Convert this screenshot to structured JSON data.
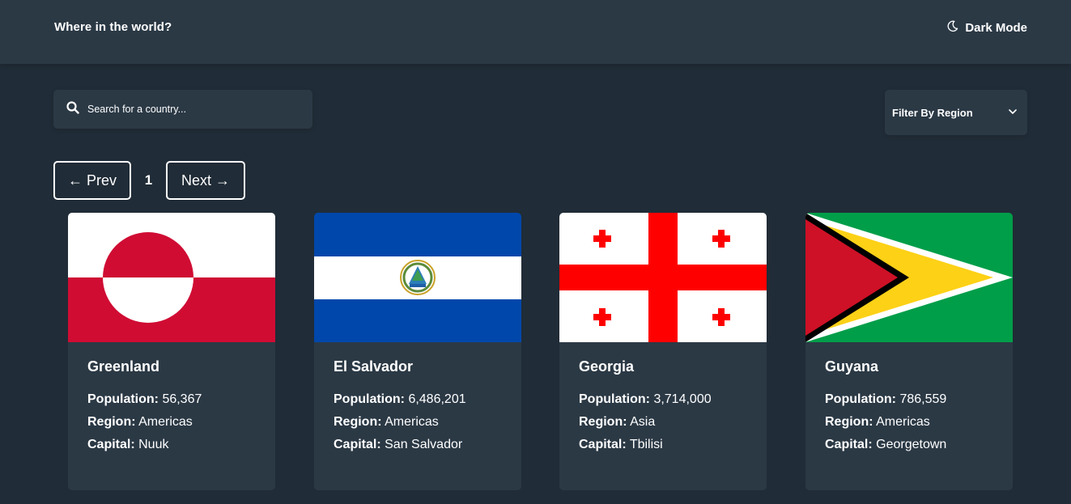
{
  "header": {
    "title": "Where in the world?",
    "mode_label": "Dark Mode"
  },
  "search": {
    "placeholder": "Search for a country..."
  },
  "filter": {
    "label": "Filter By Region"
  },
  "pagination": {
    "prev_label": "← Prev",
    "current_page": "1",
    "next_label": "Next →"
  },
  "labels": {
    "population": "Population:",
    "region": "Region:",
    "capital": "Capital:"
  },
  "countries": [
    {
      "name": "Greenland",
      "population": "56,367",
      "region": "Americas",
      "capital": "Nuuk",
      "flag": "greenland-flag"
    },
    {
      "name": "El Salvador",
      "population": "6,486,201",
      "region": "Americas",
      "capital": "San Salvador",
      "flag": "el-salvador-flag"
    },
    {
      "name": "Georgia",
      "population": "3,714,000",
      "region": "Asia",
      "capital": "Tbilisi",
      "flag": "georgia-flag"
    },
    {
      "name": "Guyana",
      "population": "786,559",
      "region": "Americas",
      "capital": "Georgetown",
      "flag": "guyana-flag"
    }
  ],
  "colors": {
    "background": "#202c37",
    "surface": "#2b3945",
    "text": "#ffffff"
  }
}
